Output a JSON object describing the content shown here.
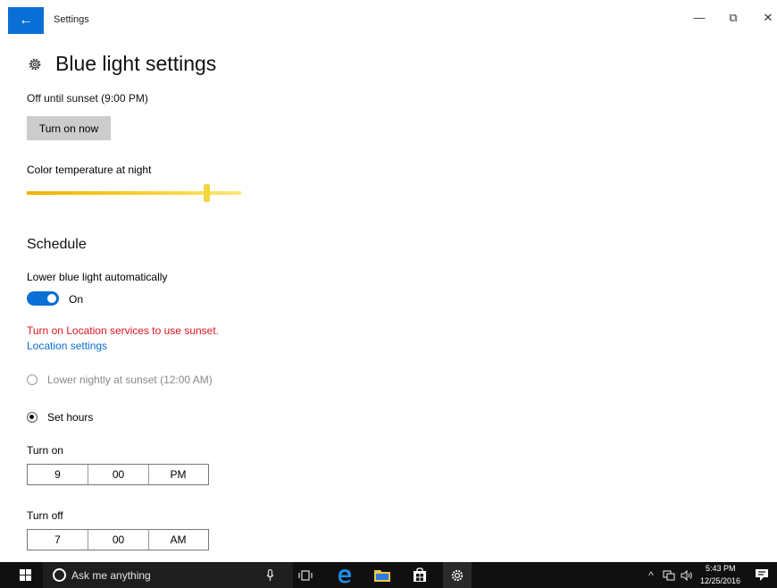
{
  "window": {
    "title": "Settings",
    "back_glyph": "←",
    "minimize_glyph": "—",
    "restore_glyph": "⧉",
    "close_glyph": "✕"
  },
  "page": {
    "title": "Blue light settings",
    "status": "Off until sunset (9:00 PM)",
    "turn_on_button": "Turn on now",
    "color_temp_label": "Color temperature at night",
    "color_temp_level": 0.84
  },
  "schedule": {
    "title": "Schedule",
    "auto_label": "Lower blue light automatically",
    "toggle_state": "On",
    "warning": "Turn on Location services to use sunset.",
    "location_link": "Location settings",
    "option_sunset": "Lower nightly at sunset (12:00 AM)",
    "option_set_hours": "Set hours",
    "turn_on_label": "Turn on",
    "turn_on_time": {
      "hour": "9",
      "minute": "00",
      "ampm": "PM"
    },
    "turn_off_label": "Turn off",
    "turn_off_time": {
      "hour": "7",
      "minute": "00",
      "ampm": "AM"
    }
  },
  "taskbar": {
    "search_placeholder": "Ask me anything",
    "time": "5:43 PM",
    "date": "12/25/2016"
  },
  "colors": {
    "accent": "#0a6fd6",
    "warning": "#e0141e",
    "taskbar": "#101010"
  }
}
